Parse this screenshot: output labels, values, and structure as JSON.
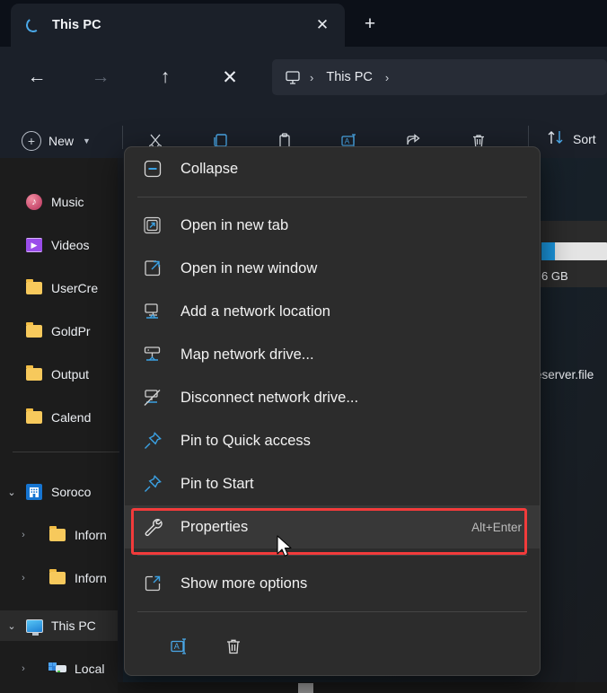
{
  "window": {
    "tab": {
      "title": "This PC",
      "spinner_icon": "loading-spinner-icon",
      "close_label": "✕"
    },
    "new_tab_label": "+"
  },
  "navigation": {
    "back_label": "←",
    "forward_label": "→",
    "up_label": "↑",
    "stop_label": "✕",
    "breadcrumb": {
      "root_icon": "this-pc-monitor-icon",
      "separator": "›",
      "items": [
        "This PC"
      ],
      "trailing_separator": "›"
    }
  },
  "toolbar": {
    "new_label": "New",
    "new_chevron": "⌄",
    "icons": [
      "cut-icon",
      "copy-icon",
      "paste-icon",
      "rename-icon",
      "share-icon",
      "delete-icon"
    ],
    "sort_label": "Sort",
    "sort_icon": "sort-arrows-icon"
  },
  "sidebar": {
    "items": [
      {
        "label": "Music",
        "icon": "music-icon",
        "chevron": "",
        "selected": false
      },
      {
        "label": "Videos",
        "icon": "video-icon",
        "chevron": "",
        "selected": false
      },
      {
        "label": "UserCre",
        "icon": "folder-icon",
        "chevron": "",
        "selected": false
      },
      {
        "label": "GoldPr",
        "icon": "folder-icon",
        "chevron": "",
        "selected": false
      },
      {
        "label": "Output",
        "icon": "folder-icon",
        "chevron": "",
        "selected": false
      },
      {
        "label": "Calend",
        "icon": "folder-icon",
        "chevron": "",
        "selected": false
      },
      {
        "label": "Soroco",
        "icon": "building-icon",
        "chevron": "⌄",
        "selected": false
      },
      {
        "label": "Inforn",
        "icon": "folder-icon",
        "chevron": "›",
        "selected": false
      },
      {
        "label": "Inforn",
        "icon": "folder-icon",
        "chevron": "›",
        "selected": false
      },
      {
        "label": "This PC",
        "icon": "this-pc-icon",
        "chevron": "⌄",
        "selected": true
      },
      {
        "label": "Local",
        "icon": "local-disk-icon",
        "chevron": "›",
        "selected": false
      }
    ]
  },
  "content": {
    "drive_free_space": "6 GB",
    "network_location": "eserver.file"
  },
  "context_menu": {
    "items": [
      {
        "label": "Collapse",
        "icon": "collapse-minus-icon",
        "accel": "",
        "highlighted": false,
        "separator_after": true
      },
      {
        "label": "Open in new tab",
        "icon": "open-in-new-tab-icon",
        "accel": "",
        "highlighted": false,
        "separator_after": false
      },
      {
        "label": "Open in new window",
        "icon": "open-in-new-window-icon",
        "accel": "",
        "highlighted": false,
        "separator_after": false
      },
      {
        "label": "Add a network location",
        "icon": "add-network-location-icon",
        "accel": "",
        "highlighted": false,
        "separator_after": false
      },
      {
        "label": "Map network drive...",
        "icon": "map-network-drive-icon",
        "accel": "",
        "highlighted": false,
        "separator_after": false
      },
      {
        "label": "Disconnect network drive...",
        "icon": "disconnect-network-drive-icon",
        "accel": "",
        "highlighted": false,
        "separator_after": false
      },
      {
        "label": "Pin to Quick access",
        "icon": "pin-icon",
        "accel": "",
        "highlighted": false,
        "separator_after": false
      },
      {
        "label": "Pin to Start",
        "icon": "pin-icon",
        "accel": "",
        "highlighted": false,
        "separator_after": false
      },
      {
        "label": "Properties",
        "icon": "wrench-icon",
        "accel": "Alt+Enter",
        "highlighted": true,
        "separator_after": true
      },
      {
        "label": "Show more options",
        "icon": "show-more-options-icon",
        "accel": "",
        "highlighted": false,
        "separator_after": true
      }
    ],
    "bottom_icons": [
      "rename-icon",
      "delete-icon"
    ]
  },
  "annotation": {
    "highlight_color": "#f23b3b",
    "target": "Properties"
  }
}
